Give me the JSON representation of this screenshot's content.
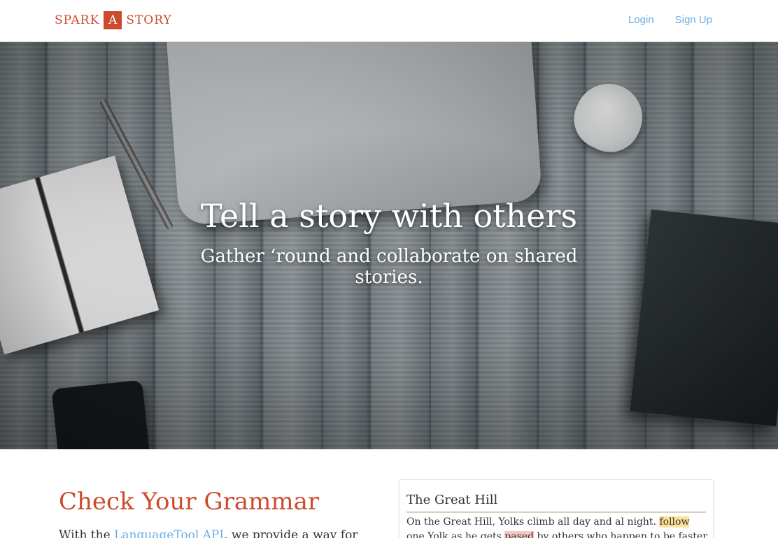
{
  "navbar": {
    "logo": {
      "left": "SPARK",
      "box": "A",
      "right": "STORY"
    },
    "login_label": "Login",
    "signup_label": "Sign Up"
  },
  "hero": {
    "title": "Tell a story with others",
    "subtitle": "Gather ‘round and collaborate on shared stories."
  },
  "grammar_section": {
    "title": "Check Your Grammar",
    "body_prefix": "With the ",
    "body_link": "LanguageTool API",
    "body_suffix": ", we provide a way for"
  },
  "sample_story": {
    "title": "The Great Hill",
    "text_1": "On the Great Hill, Yolks climb all day and al night. ",
    "highlight_1": "follow",
    "text_2": " one Yolk as he gets ",
    "highlight_2": "pased",
    "text_3": " by others who happen to be faster at"
  },
  "colors": {
    "brand": "#cc4b2c",
    "link": "#6aaee6",
    "highlight_warning": "#fbe39a",
    "highlight_error": "#f6c7c7"
  }
}
